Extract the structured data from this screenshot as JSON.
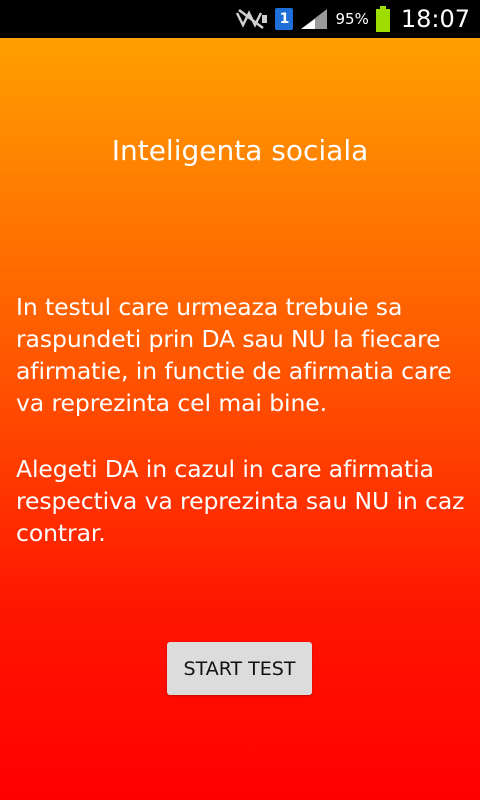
{
  "status_bar": {
    "sim_label": "1",
    "battery_percent": "95%",
    "time": "18:07",
    "icons": [
      "mute-icon",
      "sim-icon",
      "signal-icon",
      "battery-icon"
    ]
  },
  "screen": {
    "title": "Inteligenta sociala",
    "paragraph_1": "In testul care urmeaza trebuie sa raspundeti prin DA sau NU la fiecare afirmatie, in functie de afirmatia care va reprezinta cel mai bine.",
    "paragraph_2": "Alegeti DA in cazul in care afirmatia respectiva va reprezinta sau NU in caz contrar.",
    "start_button_label": "START TEST",
    "background_colors": [
      "#ff9f00",
      "#ff0000"
    ]
  }
}
